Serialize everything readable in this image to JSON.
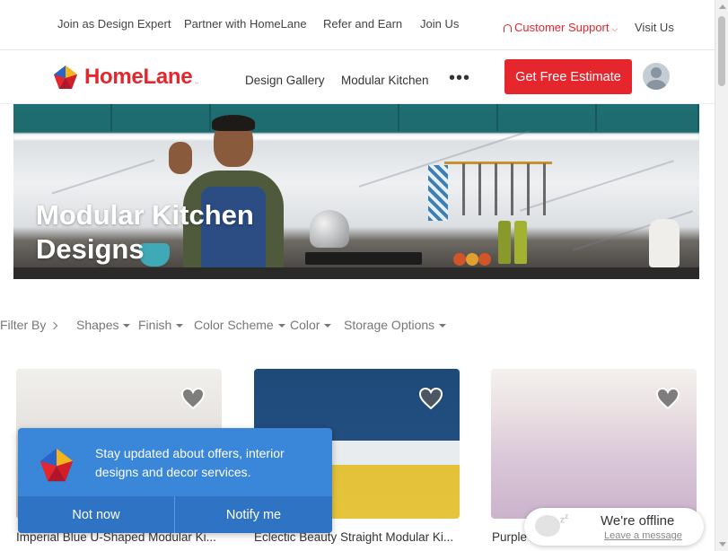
{
  "topbar": {
    "links": [
      "Join as Design Expert",
      "Partner with HomeLane",
      "Refer and Earn",
      "Join Us"
    ],
    "support_label": "Customer Support",
    "visit_label": "Visit Us"
  },
  "header": {
    "brand": "HomeLane",
    "nav": [
      "Design Gallery",
      "Modular Kitchen"
    ],
    "more": "•••",
    "cta": "Get Free Estimate"
  },
  "hero": {
    "title": "Modular Kitchen\nDesigns"
  },
  "filters": {
    "label": "Filter By",
    "options": [
      "Shapes",
      "Finish",
      "Color Scheme",
      "Color",
      "Storage Options"
    ]
  },
  "cards": [
    {
      "title": "Imperial Blue U-Shaped Modular Ki..."
    },
    {
      "title": "Eclectic Beauty Straight Modular Ki..."
    },
    {
      "title": "Purple"
    }
  ],
  "notification": {
    "message": "Stay updated about offers, interior designs and decor services.",
    "decline": "Not now",
    "accept": "Notify me"
  },
  "chat": {
    "status": "We're offline",
    "link": "Leave a message"
  },
  "colors": {
    "brand_red": "#e6262d",
    "notify_blue": "#3a86d9"
  }
}
